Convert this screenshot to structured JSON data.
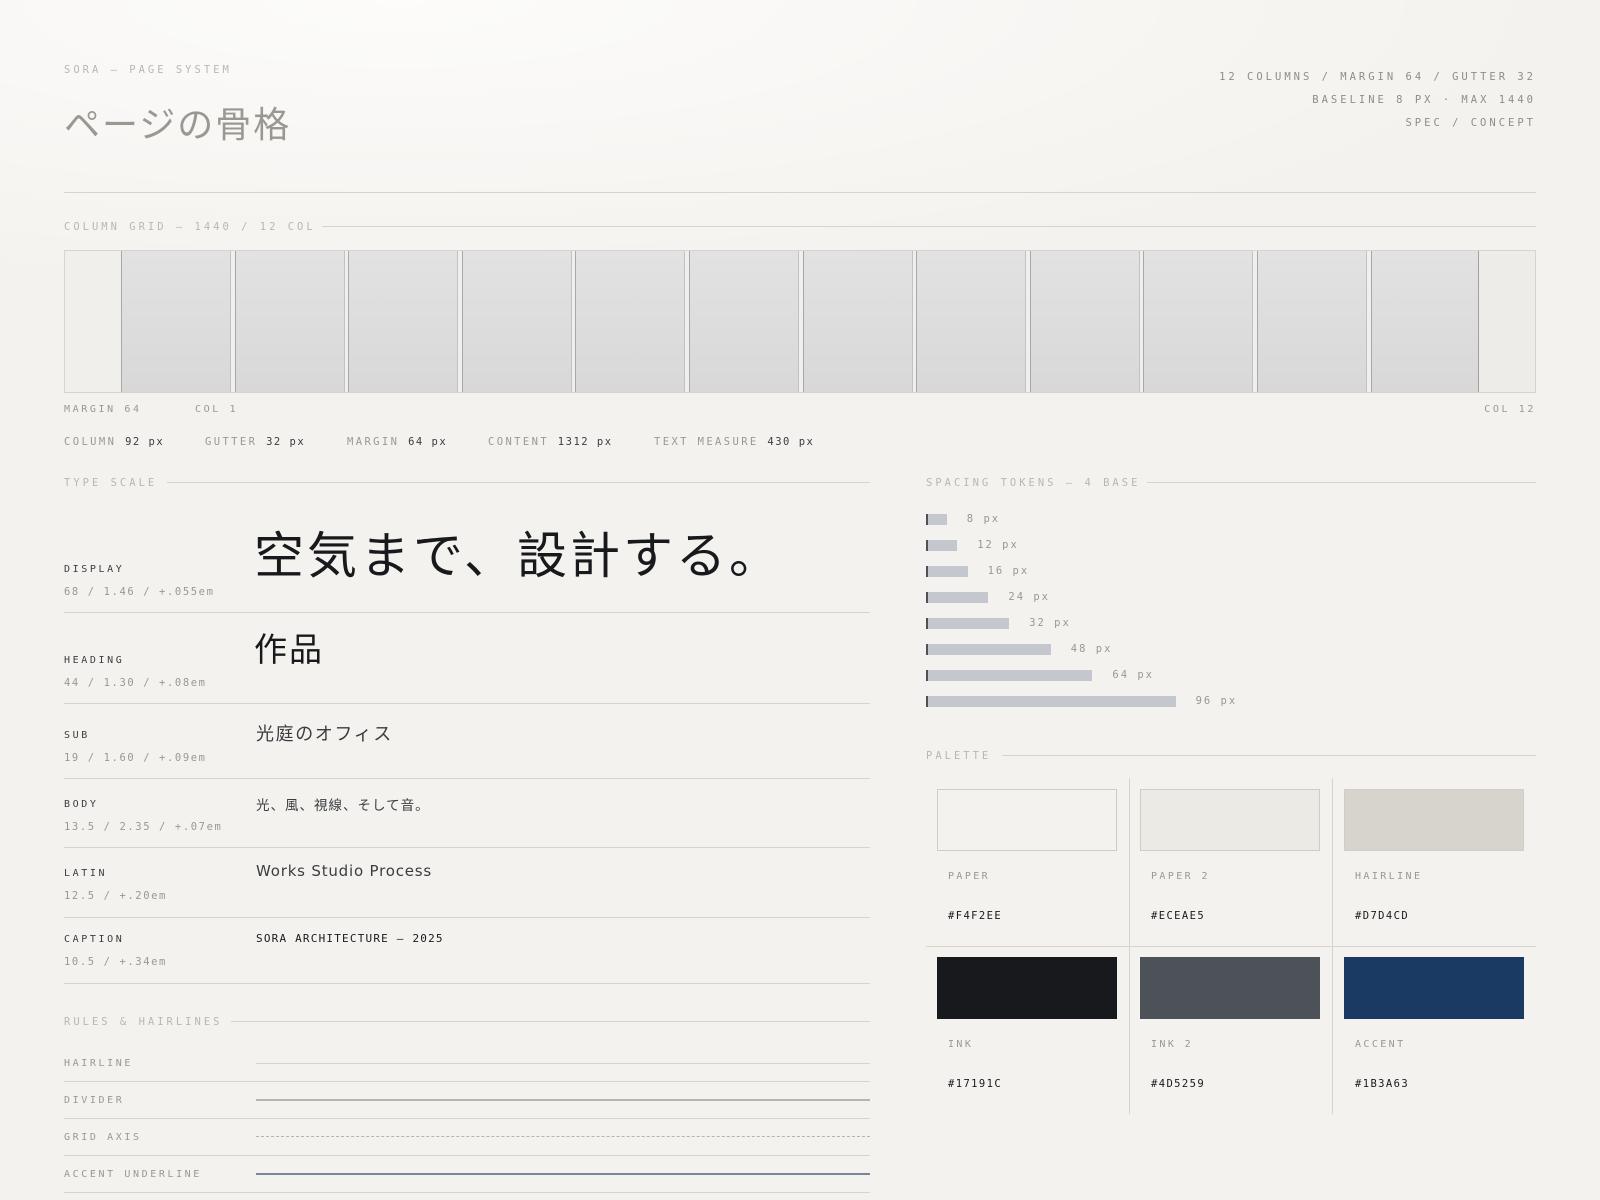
{
  "header": {
    "kicker": "SORA — PAGE SYSTEM",
    "title": "ページの骨格",
    "meta": [
      "12 COLUMNS / MARGIN 64 / GUTTER 32",
      "BASELINE 8 PX · MAX 1440",
      "SPEC / CONCEPT"
    ]
  },
  "grid": {
    "section_title": "COLUMN GRID — 1440 / 12 COL",
    "columns": 12,
    "label_margin": "MARGIN 64",
    "label_col_first": "COL 1",
    "label_col_last": "COL 12",
    "metrics": [
      {
        "label": "COLUMN",
        "value": "92 px"
      },
      {
        "label": "GUTTER",
        "value": "32 px"
      },
      {
        "label": "MARGIN",
        "value": "64 px"
      },
      {
        "label": "CONTENT",
        "value": "1312 px"
      },
      {
        "label": "TEXT MEASURE",
        "value": "430 px"
      }
    ]
  },
  "type_scale": {
    "section_title": "TYPE SCALE",
    "rows": [
      {
        "name": "DISPLAY",
        "spec": "68 / 1.46 / +.055em",
        "sample": "空気まで、設計する。"
      },
      {
        "name": "HEADING",
        "spec": "44 / 1.30 / +.08em",
        "sample": "作品"
      },
      {
        "name": "SUB",
        "spec": "19 / 1.60 / +.09em",
        "sample": "光庭のオフィス"
      },
      {
        "name": "BODY",
        "spec": "13.5 / 2.35 / +.07em",
        "sample": "光、風、視線、そして音。"
      },
      {
        "name": "LATIN",
        "spec": "12.5 / +.20em",
        "sample": "Works Studio Process"
      },
      {
        "name": "CAPTION",
        "spec": "10.5 / +.34em",
        "sample": "SORA ARCHITECTURE — 2025"
      }
    ]
  },
  "rules": {
    "section_title": "RULES & HAIRLINES",
    "items": [
      "HAIRLINE",
      "DIVIDER",
      "GRID AXIS",
      "ACCENT UNDERLINE"
    ]
  },
  "spacing": {
    "section_title": "SPACING TOKENS — 4 BASE",
    "tokens": [
      {
        "value": 8,
        "label": "8 px"
      },
      {
        "value": 12,
        "label": "12 px"
      },
      {
        "value": 16,
        "label": "16 px"
      },
      {
        "value": 24,
        "label": "24 px"
      },
      {
        "value": 32,
        "label": "32 px"
      },
      {
        "value": 48,
        "label": "48 px"
      },
      {
        "value": 64,
        "label": "64 px"
      },
      {
        "value": 96,
        "label": "96 px"
      }
    ]
  },
  "palette": {
    "section_title": "PALETTE",
    "colors": [
      {
        "name": "PAPER",
        "hex": "#F4F2EE"
      },
      {
        "name": "PAPER 2",
        "hex": "#ECEAE5"
      },
      {
        "name": "HAIRLINE",
        "hex": "#D7D4CD"
      },
      {
        "name": "INK",
        "hex": "#17191C"
      },
      {
        "name": "INK 2",
        "hex": "#4D5259"
      },
      {
        "name": "ACCENT",
        "hex": "#1B3A63"
      }
    ]
  }
}
